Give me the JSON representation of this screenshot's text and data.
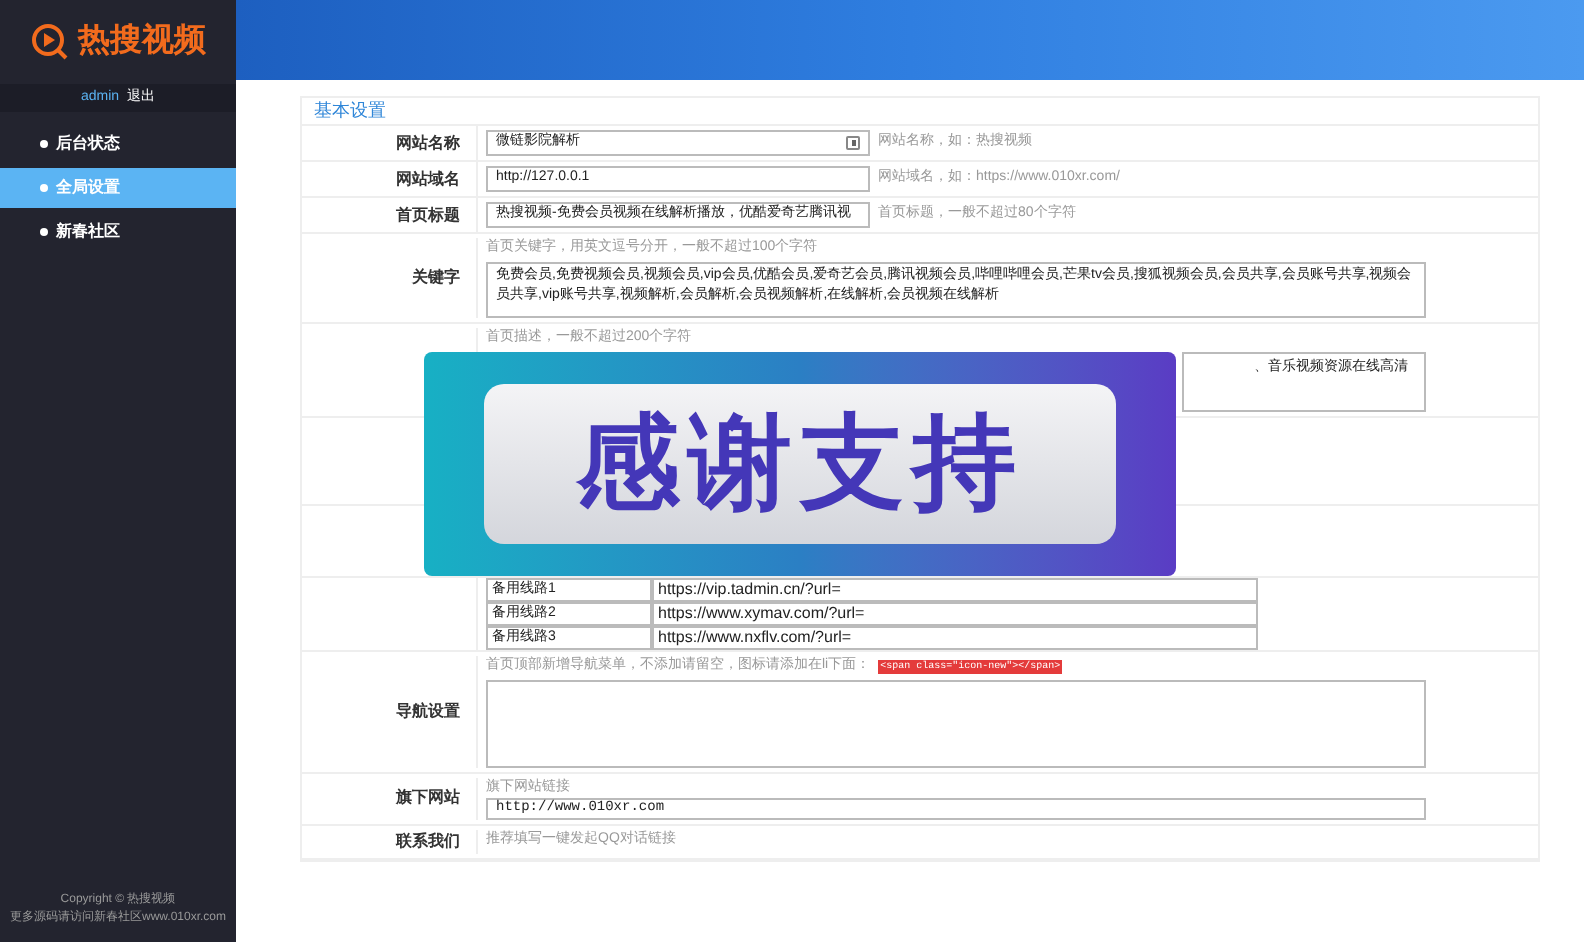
{
  "sidebar": {
    "logo": "热搜视频",
    "user": "admin",
    "logout": "退出",
    "items": [
      {
        "label": "后台状态",
        "selected": false
      },
      {
        "label": "全局设置",
        "selected": true
      },
      {
        "label": "新春社区",
        "selected": false
      }
    ],
    "copyright": "Copyright © 热搜视频",
    "footer": "更多源码请访问新春社区www.010xr.com"
  },
  "section_title": "基本设置",
  "fields": [
    {
      "kind": "inline",
      "label": "网站名称",
      "value": "微链影院解析",
      "icon": true,
      "hint": "网站名称，如：热搜视频"
    },
    {
      "kind": "inline",
      "label": "网站域名",
      "value": "http://127.0.0.1",
      "hint": "网站域名，如：https://www.010xr.com/"
    },
    {
      "kind": "inline",
      "label": "首页标题",
      "value": "热搜视频-免费会员视频在线解析播放，优酷爱奇艺腾讯视",
      "hint": "首页标题，一般不超过80个字符"
    },
    {
      "kind": "textarea",
      "label": "关键字",
      "hint": "首页关键字，用英文逗号分开，一般不超过100个字符",
      "value": "免费会员,免费视频会员,视频会员,vip会员,优酷会员,爱奇艺会员,腾讯视频会员,哔哩哔哩会员,芒果tv会员,搜狐视频会员,会员共享,会员账号共享,视频会员共享,vip账号共享,视频解析,会员解析,会员视频解析,在线解析,会员视频在线解析"
    },
    {
      "kind": "covered",
      "hint": "首页描述，一般不超过200个字符",
      "value": "、音乐视频资源在线高清"
    },
    {
      "kind": "table",
      "rows": [
        {
          "name": "备用线路1",
          "url": "https://vip.tadmin.cn/?url="
        },
        {
          "name": "备用线路2",
          "url": "https://www.xymav.com/?url="
        },
        {
          "name": "备用线路3",
          "url": "https://www.nxflv.com/?url="
        }
      ]
    },
    {
      "kind": "textarea",
      "label": "导航设置",
      "hint": "首页顶部新增导航菜单，不添加请留空，图标请添加在li下面：",
      "code": "<span class=\"icon-new\"></span>"
    },
    {
      "kind": "stacked",
      "label": "旗下网站",
      "hint": "旗下网站链接",
      "value": "http://www.010xr.com"
    },
    {
      "kind": "stacked",
      "label": "联系我们",
      "hint": "推荐填写一键发起QQ对话链接"
    }
  ],
  "banner": {
    "text": "感谢支持"
  }
}
